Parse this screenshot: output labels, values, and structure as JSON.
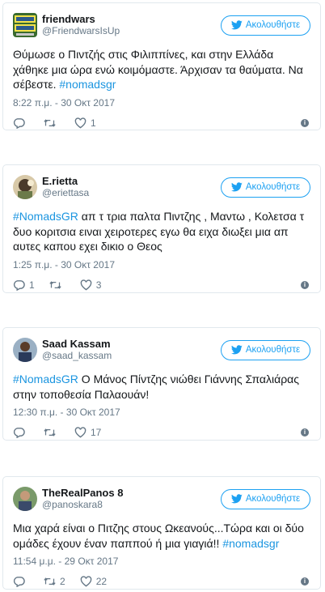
{
  "follow_label": "Ακολουθήστε",
  "tweets": [
    {
      "name": "friendwars",
      "handle": "@FriendwarsIsUp",
      "text_parts": [
        "Θύμωσε ο Πιντζής στις Φιλιππίνες, και στην Ελλάδα χάθηκε μια ώρα ενώ κοιμόμαστε. Άρχισαν τα θαύματα. Να σέβεστε. ",
        "#nomadsgr",
        ""
      ],
      "time": "8:22 π.μ. - 30 Οκτ 2017",
      "replies": "",
      "retweets": "",
      "likes": "1"
    },
    {
      "name": "E.rietta",
      "handle": "@eriettasa",
      "text_parts": [
        "",
        "#NomadsGR",
        " απ τ τρια παλτα Πιντζης , Μαντω , Κολετσα τ δυο κοριτσια ειναι χειροτερες εγω θα ειχα διωξει μια απ αυτες καπου εχει δικιο ο Θεος"
      ],
      "time": "1:25 π.μ. - 30 Οκτ 2017",
      "replies": "1",
      "retweets": "",
      "likes": "3"
    },
    {
      "name": "Saad Kassam",
      "handle": "@saad_kassam",
      "text_parts": [
        "",
        "#NomadsGR",
        " Ο Μάνος Πίντζης νιώθει Γιάννης Σπαλιάρας στην τοποθεσία Παλαουάν!"
      ],
      "time": "12:30 π.μ. - 30 Οκτ 2017",
      "replies": "",
      "retweets": "",
      "likes": "17"
    },
    {
      "name": "TheRealPanos 8",
      "handle": "@panoskara8",
      "text_parts": [
        "Μια χαρά είναι ο Πιτζης στους Ωκεανούς...Τώρα και οι δύο ομάδες έχουν έναν παππού ή μια γιαγιά!! ",
        "#nomadsgr",
        ""
      ],
      "time": "11:54 μ.μ. - 29 Οκτ 2017",
      "replies": "",
      "retweets": "2",
      "likes": "22"
    }
  ],
  "colors": {
    "accent": "#1da1f2",
    "hashtag": "#1b95e0",
    "muted": "#657786",
    "border": "#e1e8ed"
  }
}
